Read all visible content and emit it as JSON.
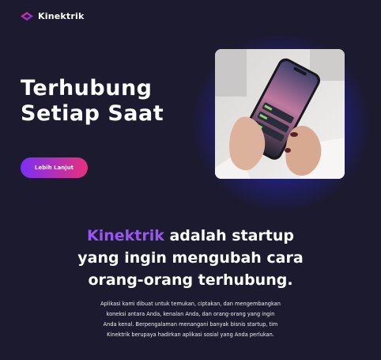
{
  "header": {
    "brand": "Kinektrik",
    "logo_icon": "diamond-logo-icon"
  },
  "hero": {
    "title_line1": "Terhubung",
    "title_line2": "Setiap Saat",
    "cta_label": "Lebih Lanjut",
    "cta_gradient": [
      "#7b2ff7",
      "#e8307a"
    ],
    "image_icon": "phone-in-hands-photo"
  },
  "about": {
    "lead_brand": "Kinektrik",
    "lead_rest_line1": " adalah startup",
    "lead_line2": "yang ingin mengubah cara",
    "lead_line3": "orang-orang terhubung.",
    "accent_color": "#9b55f4",
    "description_line1": "Aplikasi kami dibuat untuk temukan, ciptakan, dan mengembangkan",
    "description_line2": "koneksi antara Anda, kenalan Anda, dan orang-orang yang ingin",
    "description_line3": "Anda kenal. Berpengalaman menangani banyak bisnis startup, tim",
    "description_line4": "Kinektrik berupaya hadirkan aplikasi sosial yang Anda perlukan."
  },
  "colors": {
    "background": "#1c1a2e",
    "glow": "#3c3cff"
  }
}
